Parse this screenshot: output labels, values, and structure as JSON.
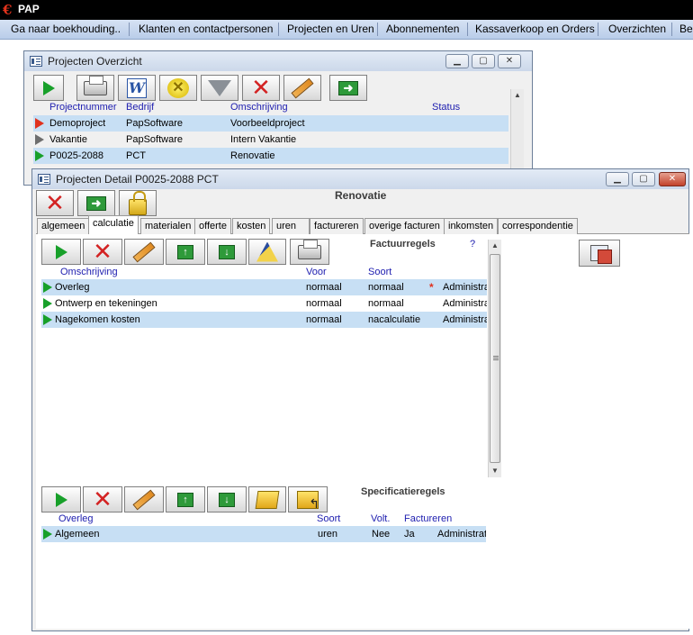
{
  "app": {
    "logo": "€",
    "title": "PAP"
  },
  "menu": {
    "items": [
      "Ga naar boekhouding..",
      "Klanten en contactpersonen",
      "Projecten en Uren",
      "Abonnementen",
      "Kassaverkoop en Orders",
      "Overzichten",
      "Beh"
    ]
  },
  "overview_window": {
    "title": "Projecten Overzicht",
    "controls": {
      "minimize": "▁",
      "maximize": "▢",
      "close": "✕"
    },
    "toolbar_icons": [
      "play-icon",
      "printer-icon",
      "word-icon",
      "tools-icon",
      "filter-icon",
      "delete-icon",
      "edit-icon",
      "exit-icon"
    ],
    "columns": [
      "Projectnummer",
      "Bedrijf",
      "Omschrijving",
      "Status"
    ],
    "rows": [
      {
        "indicator": "red",
        "projectnummer": "Demoproject",
        "bedrijf": "PapSoftware",
        "omschrijving": "Voorbeeldproject",
        "status": ""
      },
      {
        "indicator": "gray",
        "projectnummer": "Vakantie",
        "bedrijf": "PapSoftware",
        "omschrijving": "Intern Vakantie",
        "status": ""
      },
      {
        "indicator": "green",
        "projectnummer": "P0025-2088",
        "bedrijf": "PCT",
        "omschrijving": "Renovatie",
        "status": ""
      }
    ]
  },
  "detail_window": {
    "title": "Projecten Detail  P0025-2088   PCT",
    "controls": {
      "minimize": "▁",
      "maximize": "▢",
      "close": "✕"
    },
    "heading": "Renovatie",
    "tabs": [
      "algemeen",
      "calculatie",
      "materialen",
      "offerte",
      "kosten",
      "uren",
      "factureren",
      "overige facturen",
      "inkomsten",
      "correspondentie"
    ],
    "active_tab": "calculatie",
    "factuur": {
      "title": "Factuurregels",
      "help": "?",
      "columns": [
        "Omschrijving",
        "Voor",
        "Soort"
      ],
      "rows": [
        {
          "omschrijving": "Overleg",
          "voor": "normaal",
          "soort": "normaal",
          "flag": "*",
          "extra": "Administra"
        },
        {
          "omschrijving": "Ontwerp en tekeningen",
          "voor": "normaal",
          "soort": "normaal",
          "flag": "",
          "extra": "Administra"
        },
        {
          "omschrijving": "Nagekomen kosten",
          "voor": "normaal",
          "soort": "nacalculatie",
          "flag": "",
          "extra": "Administra"
        }
      ]
    },
    "specificatie": {
      "title": "Specificatieregels",
      "columns": [
        "Overleg",
        "Soort",
        "Volt.",
        "Factureren"
      ],
      "rows": [
        {
          "omschrijving": "Algemeen",
          "soort": "uren",
          "volt": "Nee",
          "factureren": "Ja",
          "extra": "Administratie"
        }
      ]
    },
    "scroll": {
      "up": "▲",
      "down": "▼"
    }
  },
  "colors": {
    "accent_blue": "#2020b0",
    "selected_row": "#c7dff4",
    "title_bar": "#000000"
  }
}
